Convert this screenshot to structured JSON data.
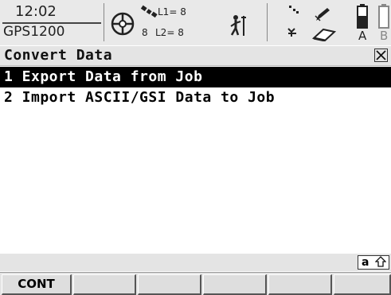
{
  "status_bar": {
    "time": "12:02",
    "device": "GPS1200",
    "satellites": {
      "l1": "L1= 8",
      "l2": "L2= 8",
      "count": "8"
    },
    "memory_labels": [
      "A",
      "B"
    ],
    "icons": [
      "satellite-crosshair-icon",
      "satellite-signal-icon",
      "rover-survey-icon",
      "link-icon",
      "radio-antenna-icon",
      "pen-icon",
      "cf-card-icon",
      "battery-a-icon",
      "battery-b-icon"
    ]
  },
  "window": {
    "title": "Convert Data",
    "close_icon": "close-x-icon"
  },
  "menu": {
    "items": [
      {
        "label": "1 Export Data from Job",
        "selected": true
      },
      {
        "label": "2 Import ASCII/GSI Data to Job",
        "selected": false
      }
    ]
  },
  "input_mode": {
    "label": "a",
    "icon": "shift-arrow-icon"
  },
  "softkeys": [
    "CONT",
    "",
    "",
    "",
    "",
    ""
  ],
  "colors": {
    "selection_bg": "#000000",
    "selection_fg": "#ffffff",
    "bar_bg": "#e4e4e4"
  }
}
